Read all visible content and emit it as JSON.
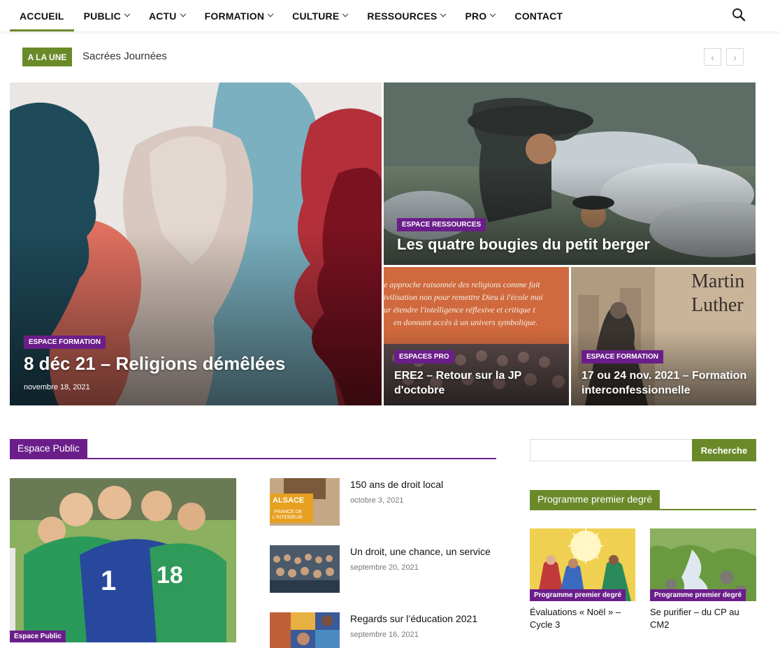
{
  "nav": {
    "items": [
      {
        "label": "ACCUEIL",
        "dropdown": false
      },
      {
        "label": "PUBLIC",
        "dropdown": true
      },
      {
        "label": "ACTU",
        "dropdown": true
      },
      {
        "label": "FORMATION",
        "dropdown": true
      },
      {
        "label": "CULTURE",
        "dropdown": true
      },
      {
        "label": "RESSOURCES",
        "dropdown": true
      },
      {
        "label": "PRO",
        "dropdown": true
      },
      {
        "label": "CONTACT",
        "dropdown": false
      }
    ],
    "active_index": 0,
    "search_icon": "search-icon"
  },
  "ticker": {
    "badge": "A LA UNE",
    "text": "Sacrées Journées",
    "prev_icon": "chevron-left-icon",
    "next_icon": "chevron-right-icon"
  },
  "hero": {
    "main": {
      "category": "ESPACE FORMATION",
      "title": "8 déc 21 – Religions démêlées",
      "date": "novembre 18, 2021"
    },
    "top_right": {
      "category": "ESPACE RESSOURCES",
      "title": "Les quatre bougies du petit berger"
    },
    "bottom_left": {
      "category": "ESPACES PRO",
      "title": "ERE2 – Retour sur la JP d'octobre",
      "overlay_text": [
        "e approche raisonnée des religions comme fait",
        "ivilisation non pour remettre Dieu à l'école mai",
        "ur étendre l'intelligence réflexive et critique t",
        "en donnant accès à un univers symbolique."
      ]
    },
    "bottom_right": {
      "category": "ESPACE FORMATION",
      "title": "17 ou 24 nov. 2021 – Formation interconfessionnelle",
      "overlay_text": [
        "Martin",
        "Luther"
      ]
    }
  },
  "espace_public": {
    "heading": "Espace Public",
    "featured_category": "Espace Public",
    "posts": [
      {
        "title": "150 ans de droit local",
        "date": "octobre 3, 2021",
        "sign_text": [
          "ALSACE",
          "FRANCE DE",
          "L'INTERIEUR"
        ]
      },
      {
        "title": "Un droit, une chance, un service",
        "date": "septembre 20, 2021"
      },
      {
        "title": "Regards sur l’éducation 2021",
        "date": "septembre 16, 2021"
      }
    ]
  },
  "sidebar": {
    "search_placeholder": "",
    "search_button": "Recherche",
    "programme_heading": "Programme premier degré",
    "programme_posts": [
      {
        "category": "Programme premier degré",
        "title": "Évaluations « Noël » – Cycle 3"
      },
      {
        "category": "Programme premier degré",
        "title": "Se purifier – du CP au CM2"
      }
    ]
  },
  "colors": {
    "green": "#6a8a2a",
    "purple": "#6b1e8a"
  }
}
